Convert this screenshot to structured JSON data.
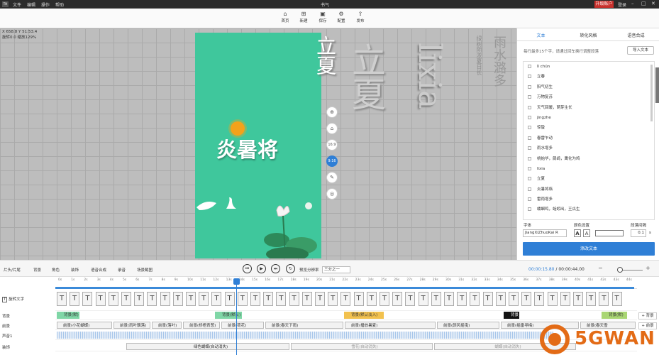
{
  "app": {
    "logo": "TH",
    "title": "书气",
    "menus": [
      "文件",
      "编辑",
      "操作",
      "帮助"
    ],
    "upgrade": "升级账户",
    "login": "登录",
    "window_buttons": [
      "–",
      "□",
      "✕"
    ]
  },
  "toolbar": [
    {
      "icon": "home-icon",
      "glyph": "⌂",
      "label": "首页"
    },
    {
      "icon": "new-icon",
      "glyph": "⊞",
      "label": "新建"
    },
    {
      "icon": "save-icon",
      "glyph": "▣",
      "label": "保存"
    },
    {
      "icon": "settings-icon",
      "glyph": "⚙",
      "label": "配置"
    },
    {
      "icon": "publish-icon",
      "glyph": "⇪",
      "label": "发布"
    }
  ],
  "canvas": {
    "coords_line1": "X 658.8 Y 51:53.4",
    "coords_line2": "旋转0.0 缩放129%",
    "heading": "炎暑将",
    "side_tools": [
      "⊕",
      "⌂",
      "16:9",
      "9:16",
      "✎",
      "◎"
    ],
    "deco1": "立夏",
    "deco2": "lixia",
    "deco3": "雨水潞多",
    "deco4": "绿树阴浓夏日长"
  },
  "panel": {
    "tabs": [
      "文本",
      "转化风格",
      "语音合成"
    ],
    "hint": "每行最多15个字，请通过回车换行调整段落",
    "import": "导入文本",
    "items": [
      "lì chūn",
      "立春",
      "阳气初生",
      "万物复苏",
      "天气回暖，萌芽生长",
      "jingzhe",
      "惊蛰",
      "春雷乍动",
      "雨水增多",
      "桃始华，鹧鸪，鹰化为鸠",
      "lixia",
      "立夏",
      "炎暑将临",
      "雷雨增多",
      "蝼蝈鸣，蚯蚓出，王瓜生"
    ],
    "font_label": "字体",
    "font_value": "JiangXiZhuoKai R",
    "color_label": "颜色设置",
    "spacing_label": "段落间隔",
    "spacing_value": "0.1",
    "spacing_unit": "s",
    "apply": "添改文本"
  },
  "controls": {
    "items": [
      "片头/片尾",
      "背景",
      "角色",
      "装饰",
      "语音合成",
      "录音",
      "场景截图"
    ],
    "ratio_label": "预览分辨率",
    "ratio_value": "三分之一",
    "time_current": "00:00:15.80",
    "time_total": "/ 00:00:44.00",
    "zoom_minus": "−",
    "zoom_plus": "+"
  },
  "ruler_ticks": [
    "0s",
    "1s",
    "2s",
    "3s",
    "4s",
    "5s",
    "6s",
    "7s",
    "8s",
    "9s",
    "10s",
    "11s",
    "12s",
    "13s",
    "14s",
    "15s",
    "16s",
    "17s",
    "18s",
    "19s",
    "20s",
    "21s",
    "22s",
    "23s",
    "24s",
    "25s",
    "26s",
    "27s",
    "28s",
    "29s",
    "30s",
    "31s",
    "32s",
    "33s",
    "34s",
    "35s",
    "36s",
    "37s",
    "38s",
    "39s",
    "40s",
    "41s",
    "42s",
    "43s",
    "44s"
  ],
  "tracks": {
    "text_label": "旋转文字",
    "bg_label": "背景",
    "bg2_label": "前景",
    "audio_label": "声音1",
    "deco_label": "装饰",
    "bg_clips": [
      "背景(默)",
      "背景(默认)",
      "背景(默认淡入)",
      "背景",
      "背景(默)"
    ],
    "bg2_clips": [
      "前景(小花蝴蝶)",
      "前景(雨叶飘落)",
      "前景(落叶)",
      "前景(桥梧青葱)",
      "前景(荷花)",
      "前景(春天下雨)",
      "前景(播放暑夏)",
      "前景(颜风摇曳)",
      "前景(插雷寻梅)",
      "前景(春天雪"
    ],
    "deco_clips": [
      "绿色蝴蝶(自动消失)",
      "雪花(自动消失)",
      "蝴蝶(自动消失)"
    ],
    "add": "+ 背景",
    "add2": "+ 前景"
  },
  "watermark": "5GWAN"
}
